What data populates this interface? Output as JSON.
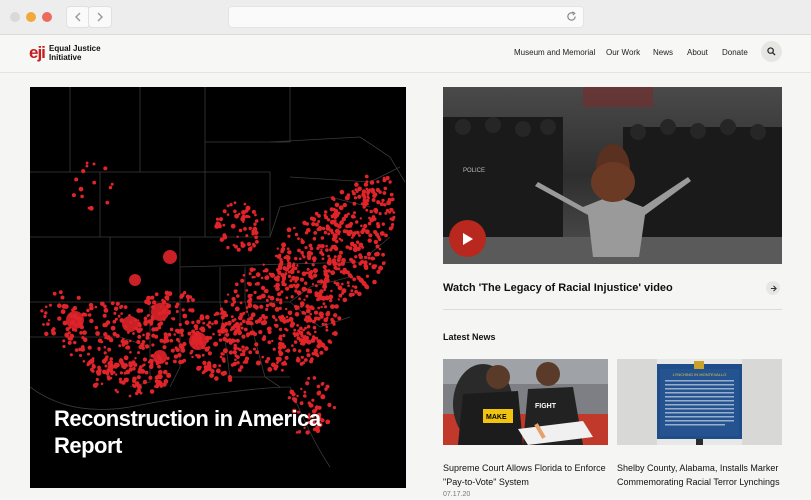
{
  "header": {
    "logo_mark": "eji",
    "logo_text_line1": "Equal Justice",
    "logo_text_line2": "Initiative",
    "menu": [
      "Museum and Memorial",
      "Our Work",
      "News",
      "About",
      "Donate"
    ]
  },
  "hero": {
    "title": "Reconstruction in America Report"
  },
  "video": {
    "link_text": "Watch 'The Legacy of Racial Injustice' video",
    "police_text": "POLICE"
  },
  "latest": {
    "heading": "Latest News",
    "items": [
      {
        "title": "Supreme Court Allows Florida to Enforce \"Pay-to-Vote\" System",
        "date": "07.17.20",
        "shirt_text": "MAKE",
        "shirt_text_2": "FIGHT"
      },
      {
        "title": "Shelby County, Alabama, Installs Marker Commemorating Racial Terror Lynchings",
        "date": "",
        "sign_title": "LYNCHING IN MONTEVALLO"
      }
    ]
  },
  "colors": {
    "accent": "#c41e1e",
    "play": "#b8281e",
    "map_dot": "#e0242a"
  },
  "icons": {
    "back": "chevron-left-icon",
    "forward": "chevron-right-icon",
    "reload": "reload-icon",
    "search": "search-icon",
    "play": "play-icon",
    "arrow": "arrow-right-icon"
  }
}
